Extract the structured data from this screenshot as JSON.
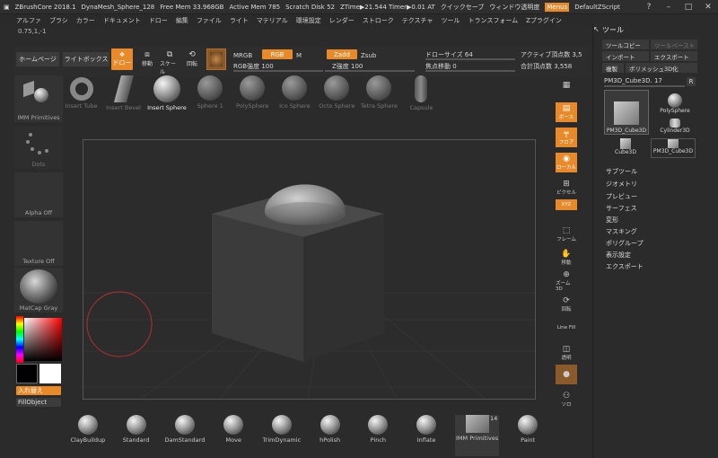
{
  "titlebar": {
    "app": "ZBrushCore 2018.1",
    "doc": "DynaMesh_Sphere_128",
    "free_mem": "Free Mem 33.968GB",
    "active_mem": "Active Mem 785",
    "scratch": "Scratch Disk 52",
    "ztime": "ZTime▶21.544 Timer▶0.01 AT",
    "quicksave": "クイックセーブ",
    "transparency": "ウィンドウ透明度",
    "menus": "Menus",
    "script": "DefaultZScript"
  },
  "menubar": [
    "アルファ",
    "ブラシ",
    "カラー",
    "ドキュメント",
    "ドロー",
    "編集",
    "ファイル",
    "ライト",
    "マテリアル",
    "環境設定",
    "レンダー",
    "ストローク",
    "テクスチャ",
    "ツール",
    "トランスフォーム",
    "Zプラグイン"
  ],
  "coord": "0.75,1,-1",
  "topshelf": {
    "home": "ホームページ",
    "lightbox": "ライトボックス",
    "edit": "ドロー",
    "move": "移動",
    "scale": "スケール",
    "rotate": "回転",
    "mrgb": "MRGB",
    "rgb": "RGB",
    "m": "M",
    "rgb_intensity": "RGB強度 100",
    "zadd": "Zadd",
    "zsub": "Zsub",
    "z_intensity": "Z強度 100",
    "draw_size": "ドローサイズ 64",
    "focal_shift": "焦点移動 0",
    "active_points": "アクティブ頂点数 3,5",
    "total_points": "合計頂点数 3,558"
  },
  "brushrow": [
    {
      "label": "Insert Tube"
    },
    {
      "label": "Insert Bevel"
    },
    {
      "label": "Insert Sphere"
    },
    {
      "label": "Sphere 1"
    },
    {
      "label": "PolySphere"
    },
    {
      "label": "Ico Sphere"
    },
    {
      "label": "Octo Sphere"
    },
    {
      "label": "Tetra Sphere"
    },
    {
      "label": "Capsule"
    }
  ],
  "leftpanel": {
    "imm": "IMM Primitives",
    "dots": "Dots",
    "alpha": "Alpha Off",
    "texture": "Texture Off",
    "matcap": "MatCap Gray",
    "swap": "入れ替え",
    "fillobject": "FillObject"
  },
  "rightstrip": [
    "フレーム",
    "フロア",
    "ローカル",
    "XYZ",
    "",
    "フレーム",
    "移動",
    "ズーム3D",
    "回転",
    "ポリ F",
    "透明",
    "",
    "ソロ"
  ],
  "rightstrip_top": [
    "ボース",
    "フロア",
    "ローカル",
    "ピクセル",
    "XYZ",
    "",
    "フレーム",
    "移動",
    "ズーム3D",
    "回転",
    "Line Fill",
    "透明",
    "",
    "ソロ"
  ],
  "tool": {
    "title": "ツール",
    "copy": "ツールコピー",
    "paste": "ツールペースト",
    "import": "インポート",
    "export": "エクスポート",
    "clone": "複製",
    "make3d": "ポリメッシュ3D化",
    "current": "PM3D_Cube3D. 17",
    "r": "R",
    "thumbs": [
      "PM3D_Cube3D",
      "PolySphere",
      "Cylinder3D",
      "Cube3D",
      "PM3D_Cube3D"
    ],
    "menus": [
      "サブツール",
      "ジオメトリ",
      "プレビュー",
      "サーフェス",
      "変形",
      "マスキング",
      "ポリグループ",
      "表示設定",
      "エクスポート"
    ]
  },
  "bottombar": [
    {
      "label": "ClayBuildup"
    },
    {
      "label": "Standard"
    },
    {
      "label": "DamStandard"
    },
    {
      "label": "Move"
    },
    {
      "label": "TrimDynamic"
    },
    {
      "label": "hPolish"
    },
    {
      "label": "Pinch"
    },
    {
      "label": "Inflate"
    },
    {
      "label": "IMM Primitives",
      "badge": "14"
    },
    {
      "label": "Paint"
    }
  ],
  "colors": {
    "accent": "#e8892a",
    "bg": "#2b2b2b",
    "panel": "#333333"
  }
}
